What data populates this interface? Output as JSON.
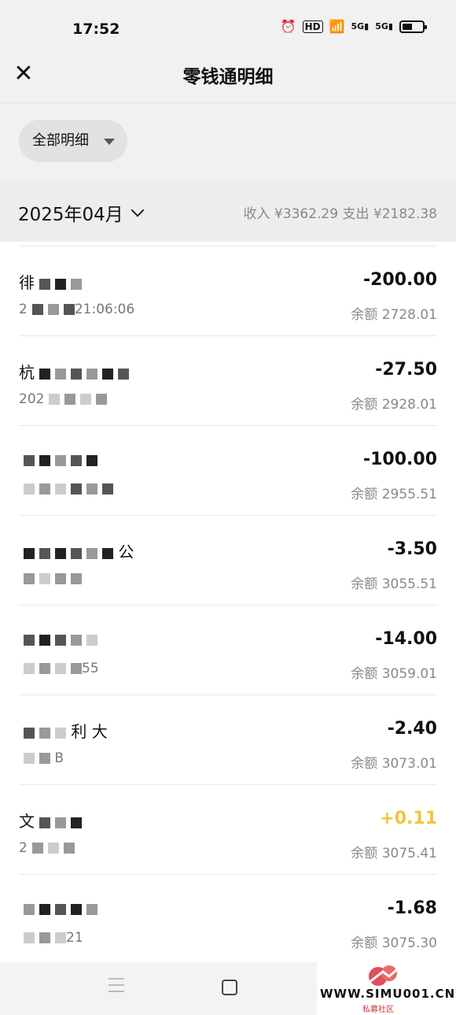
{
  "status": {
    "time": "17:52",
    "icons": [
      "alarm-icon",
      "hd-icon",
      "wifi-icon",
      "signal-5g-icon",
      "signal-5g-icon",
      "battery-icon"
    ]
  },
  "header": {
    "title": "零钱通明细",
    "close_icon": "close-icon"
  },
  "filter": {
    "label": "全部明细"
  },
  "month": {
    "label": "2025年04月",
    "summary": "收入 ¥3362.29 支出 ¥2182.38"
  },
  "transactions": [
    {
      "title": "徘",
      "date": "2",
      "time": "21:06:06",
      "amount": "-200.00",
      "balance": "余额 2728.01"
    },
    {
      "title": "杭",
      "date": "202",
      "amount": "-27.50",
      "balance": "余额 2928.01"
    },
    {
      "title": "",
      "date": "",
      "amount": "-100.00",
      "balance": "余额 2955.51"
    },
    {
      "title": "公",
      "date": "",
      "amount": "-3.50",
      "balance": "余额 3055.51"
    },
    {
      "title": "",
      "date": "55",
      "amount": "-14.00",
      "balance": "余额 3059.01"
    },
    {
      "title": "利 大",
      "date": "B",
      "amount": "-2.40",
      "balance": "余额 3073.01"
    },
    {
      "title": "文",
      "date": "2",
      "amount": "+0.11",
      "balance": "余额 3075.41"
    },
    {
      "title": "",
      "date": "21",
      "amount": "-1.68",
      "balance": "余额 3075.30"
    }
  ],
  "colors": {
    "income": "#f0c63a",
    "background": "#f1f1f1"
  },
  "watermark": {
    "text": "WWW.SIMU001.CN",
    "sub": "私募社区"
  }
}
